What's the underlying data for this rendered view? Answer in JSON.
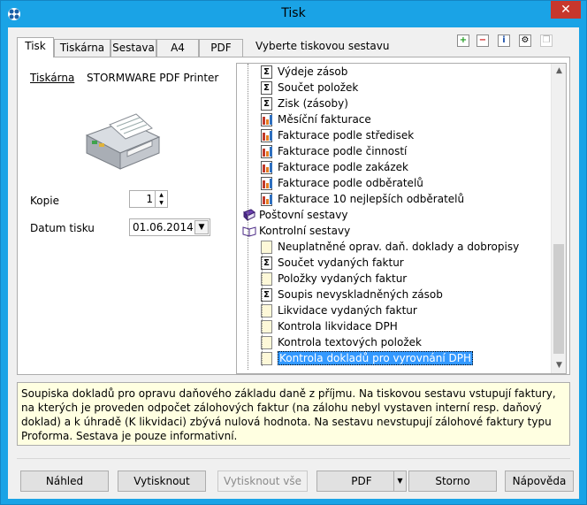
{
  "window": {
    "title": "Tisk"
  },
  "tabs": [
    {
      "label": "Tisk",
      "active": true
    },
    {
      "label": "Tiskárna"
    },
    {
      "label": "Sestava"
    },
    {
      "label": "A4"
    },
    {
      "label": "PDF"
    }
  ],
  "tab_hint": "Vyberte tiskovou sestavu",
  "toolbar": {
    "icons": [
      "add-icon",
      "remove-icon",
      "info-icon",
      "settings-icon",
      "copy-icon"
    ]
  },
  "printer": {
    "link_label": "Tiskárna",
    "name": "STORMWARE PDF Printer"
  },
  "copies": {
    "label": "Kopie",
    "value": "1"
  },
  "print_date": {
    "label": "Datum tisku",
    "value": "01.06.2014"
  },
  "tree": {
    "items": [
      {
        "label": "Výdeje zásob",
        "icon": "sum",
        "level": 2
      },
      {
        "label": "Součet položek",
        "icon": "sum",
        "level": 2
      },
      {
        "label": "Zisk (zásoby)",
        "icon": "sum",
        "level": 2
      },
      {
        "label": "Měsíční fakturace",
        "icon": "chart",
        "level": 2
      },
      {
        "label": "Fakturace podle středisek",
        "icon": "chart",
        "level": 2
      },
      {
        "label": "Fakturace podle činností",
        "icon": "chart",
        "level": 2
      },
      {
        "label": "Fakturace podle zakázek",
        "icon": "chart",
        "level": 2
      },
      {
        "label": "Fakturace podle odběratelů",
        "icon": "chart",
        "level": 2
      },
      {
        "label": "Fakturace 10 nejlepších odběratelů",
        "icon": "chart",
        "level": 2
      },
      {
        "label": "Poštovní sestavy",
        "icon": "book-closed",
        "level": 1
      },
      {
        "label": "Kontrolní sestavy",
        "icon": "book-open",
        "level": 1
      },
      {
        "label": "Neuplatněné oprav. daň. doklady a dobropisy",
        "icon": "doc",
        "level": 2
      },
      {
        "label": "Součet vydaných faktur",
        "icon": "sum",
        "level": 2
      },
      {
        "label": "Položky vydaných faktur",
        "icon": "doc",
        "level": 2
      },
      {
        "label": "Soupis nevyskladněných zásob",
        "icon": "sum",
        "level": 2
      },
      {
        "label": "Likvidace vydaných faktur",
        "icon": "doc",
        "level": 2
      },
      {
        "label": "Kontrola likvidace DPH",
        "icon": "doc",
        "level": 2
      },
      {
        "label": "Kontrola textových položek",
        "icon": "doc",
        "level": 2
      },
      {
        "label": "Kontrola dokladů pro vyrovnání DPH",
        "icon": "doc",
        "level": 2,
        "selected": true
      }
    ]
  },
  "description": "Soupiska dokladů pro opravu daňového základu daně z příjmu. Na tiskovou sestavu vstupují faktury, na kterých je proveden odpočet zálohových faktur (na zálohu nebyl vystaven interní resp. daňový doklad) a k úhradě (K likvidaci) zbývá nulová hodnota. Na sestavu nevstupují zálohové faktury typu Proforma. Sestava je pouze informativní.",
  "buttons": {
    "preview": "Náhled",
    "print": "Vytisknout",
    "print_all": "Vytisknout vše",
    "pdf": "PDF",
    "cancel": "Storno",
    "help": "Nápověda"
  },
  "colors": {
    "titlebar": "#1aa3e6",
    "close": "#c7372c",
    "selection": "#3399ff",
    "description_bg": "#ffffe1"
  }
}
